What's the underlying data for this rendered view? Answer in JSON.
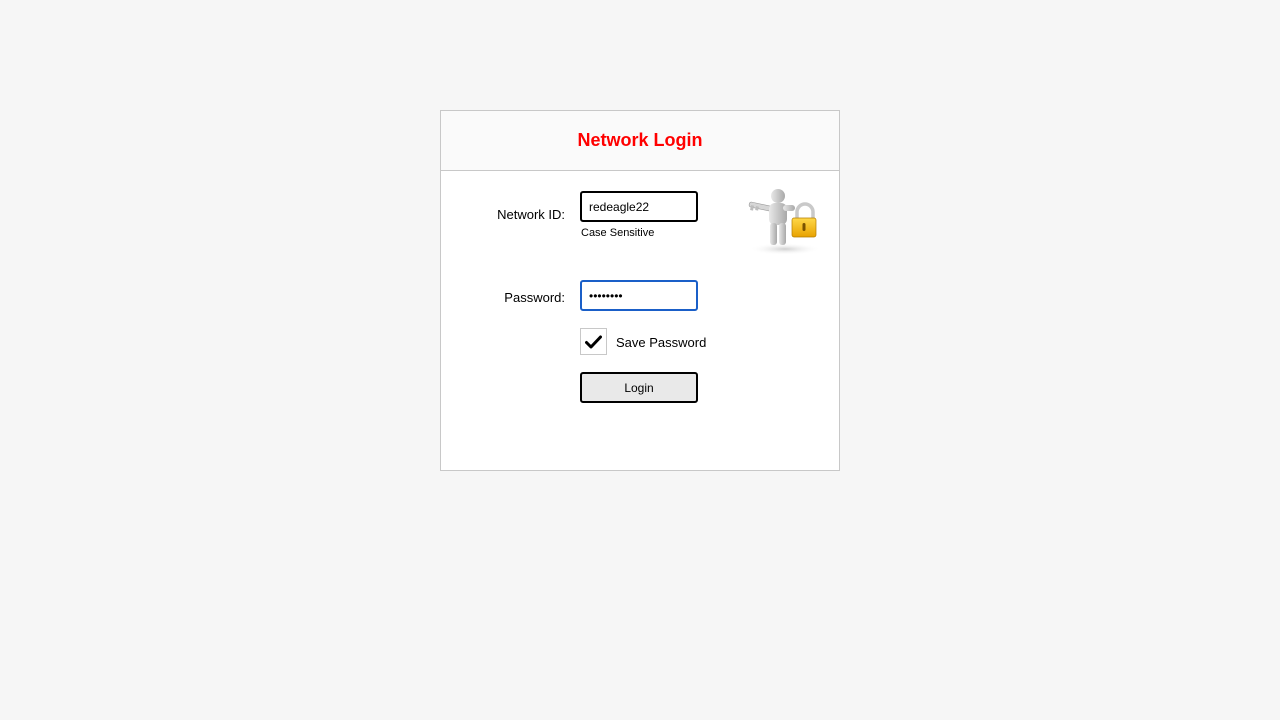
{
  "panel": {
    "title": "Network Login"
  },
  "form": {
    "network_id_label": "Network ID:",
    "network_id_value": "redeagle22",
    "network_id_hint": "Case Sensitive",
    "password_label": "Password:",
    "password_value": "********",
    "save_password_label": "Save Password",
    "save_password_checked": true,
    "login_label": "Login"
  },
  "colors": {
    "title": "#ff0000",
    "focus_border": "#1a5fc8",
    "background": "#f6f6f6"
  },
  "icons": {
    "illustration": "person-key-lock-icon",
    "checkmark": "checkmark-icon"
  }
}
